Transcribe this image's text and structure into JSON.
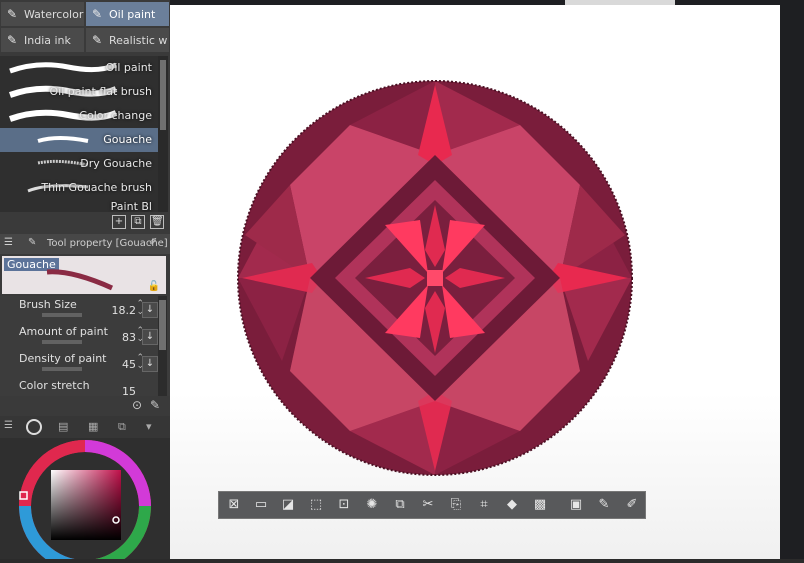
{
  "brush_tabs": {
    "row1": [
      {
        "label": "Watercolor",
        "icon": "watercolor-brush-icon",
        "active": false
      },
      {
        "label": "Oil paint",
        "icon": "oil-paint-brush-icon",
        "active": true
      }
    ],
    "row2": [
      {
        "label": "India ink",
        "icon": "india-ink-brush-icon",
        "active": false
      },
      {
        "label": "Realistic w",
        "icon": "realistic-water-brush-icon",
        "active": false
      }
    ]
  },
  "brushes": [
    {
      "label": "Oil paint"
    },
    {
      "label": "Oil paint flat brush"
    },
    {
      "label": "Color change"
    },
    {
      "label": "Gouache"
    },
    {
      "label": "Dry Gouache"
    },
    {
      "label": "Thin Gouache brush"
    },
    {
      "label": "Paint Bl"
    }
  ],
  "tool_property": {
    "header": "Tool property [Gouache]",
    "preview_label": "Gouache",
    "properties": [
      {
        "name": "Brush Size",
        "value": "18.2"
      },
      {
        "name": "Amount of paint",
        "value": "83"
      },
      {
        "name": "Density of paint",
        "value": "45"
      },
      {
        "name": "Color stretch",
        "value": "15"
      }
    ]
  },
  "colors": {
    "gem_dark": "#6b1a35",
    "gem_mid": "#a02a4c",
    "gem_light": "#c94468",
    "gem_bright": "#e8294f",
    "gem_center": "#ff3a60",
    "accent_tab": "#6b7f9a"
  },
  "toolbar_icons": [
    "deselect-icon",
    "crop-icon",
    "invert-selection-icon",
    "expand-selection-icon",
    "shrink-selection-icon",
    "selection-settings-icon",
    "copy-icon",
    "cut-icon",
    "paste-icon",
    "transform-icon",
    "fill-icon",
    "screen-tone-icon",
    "tone-settings-icon",
    "pen-icon",
    "pen-alt-icon"
  ]
}
